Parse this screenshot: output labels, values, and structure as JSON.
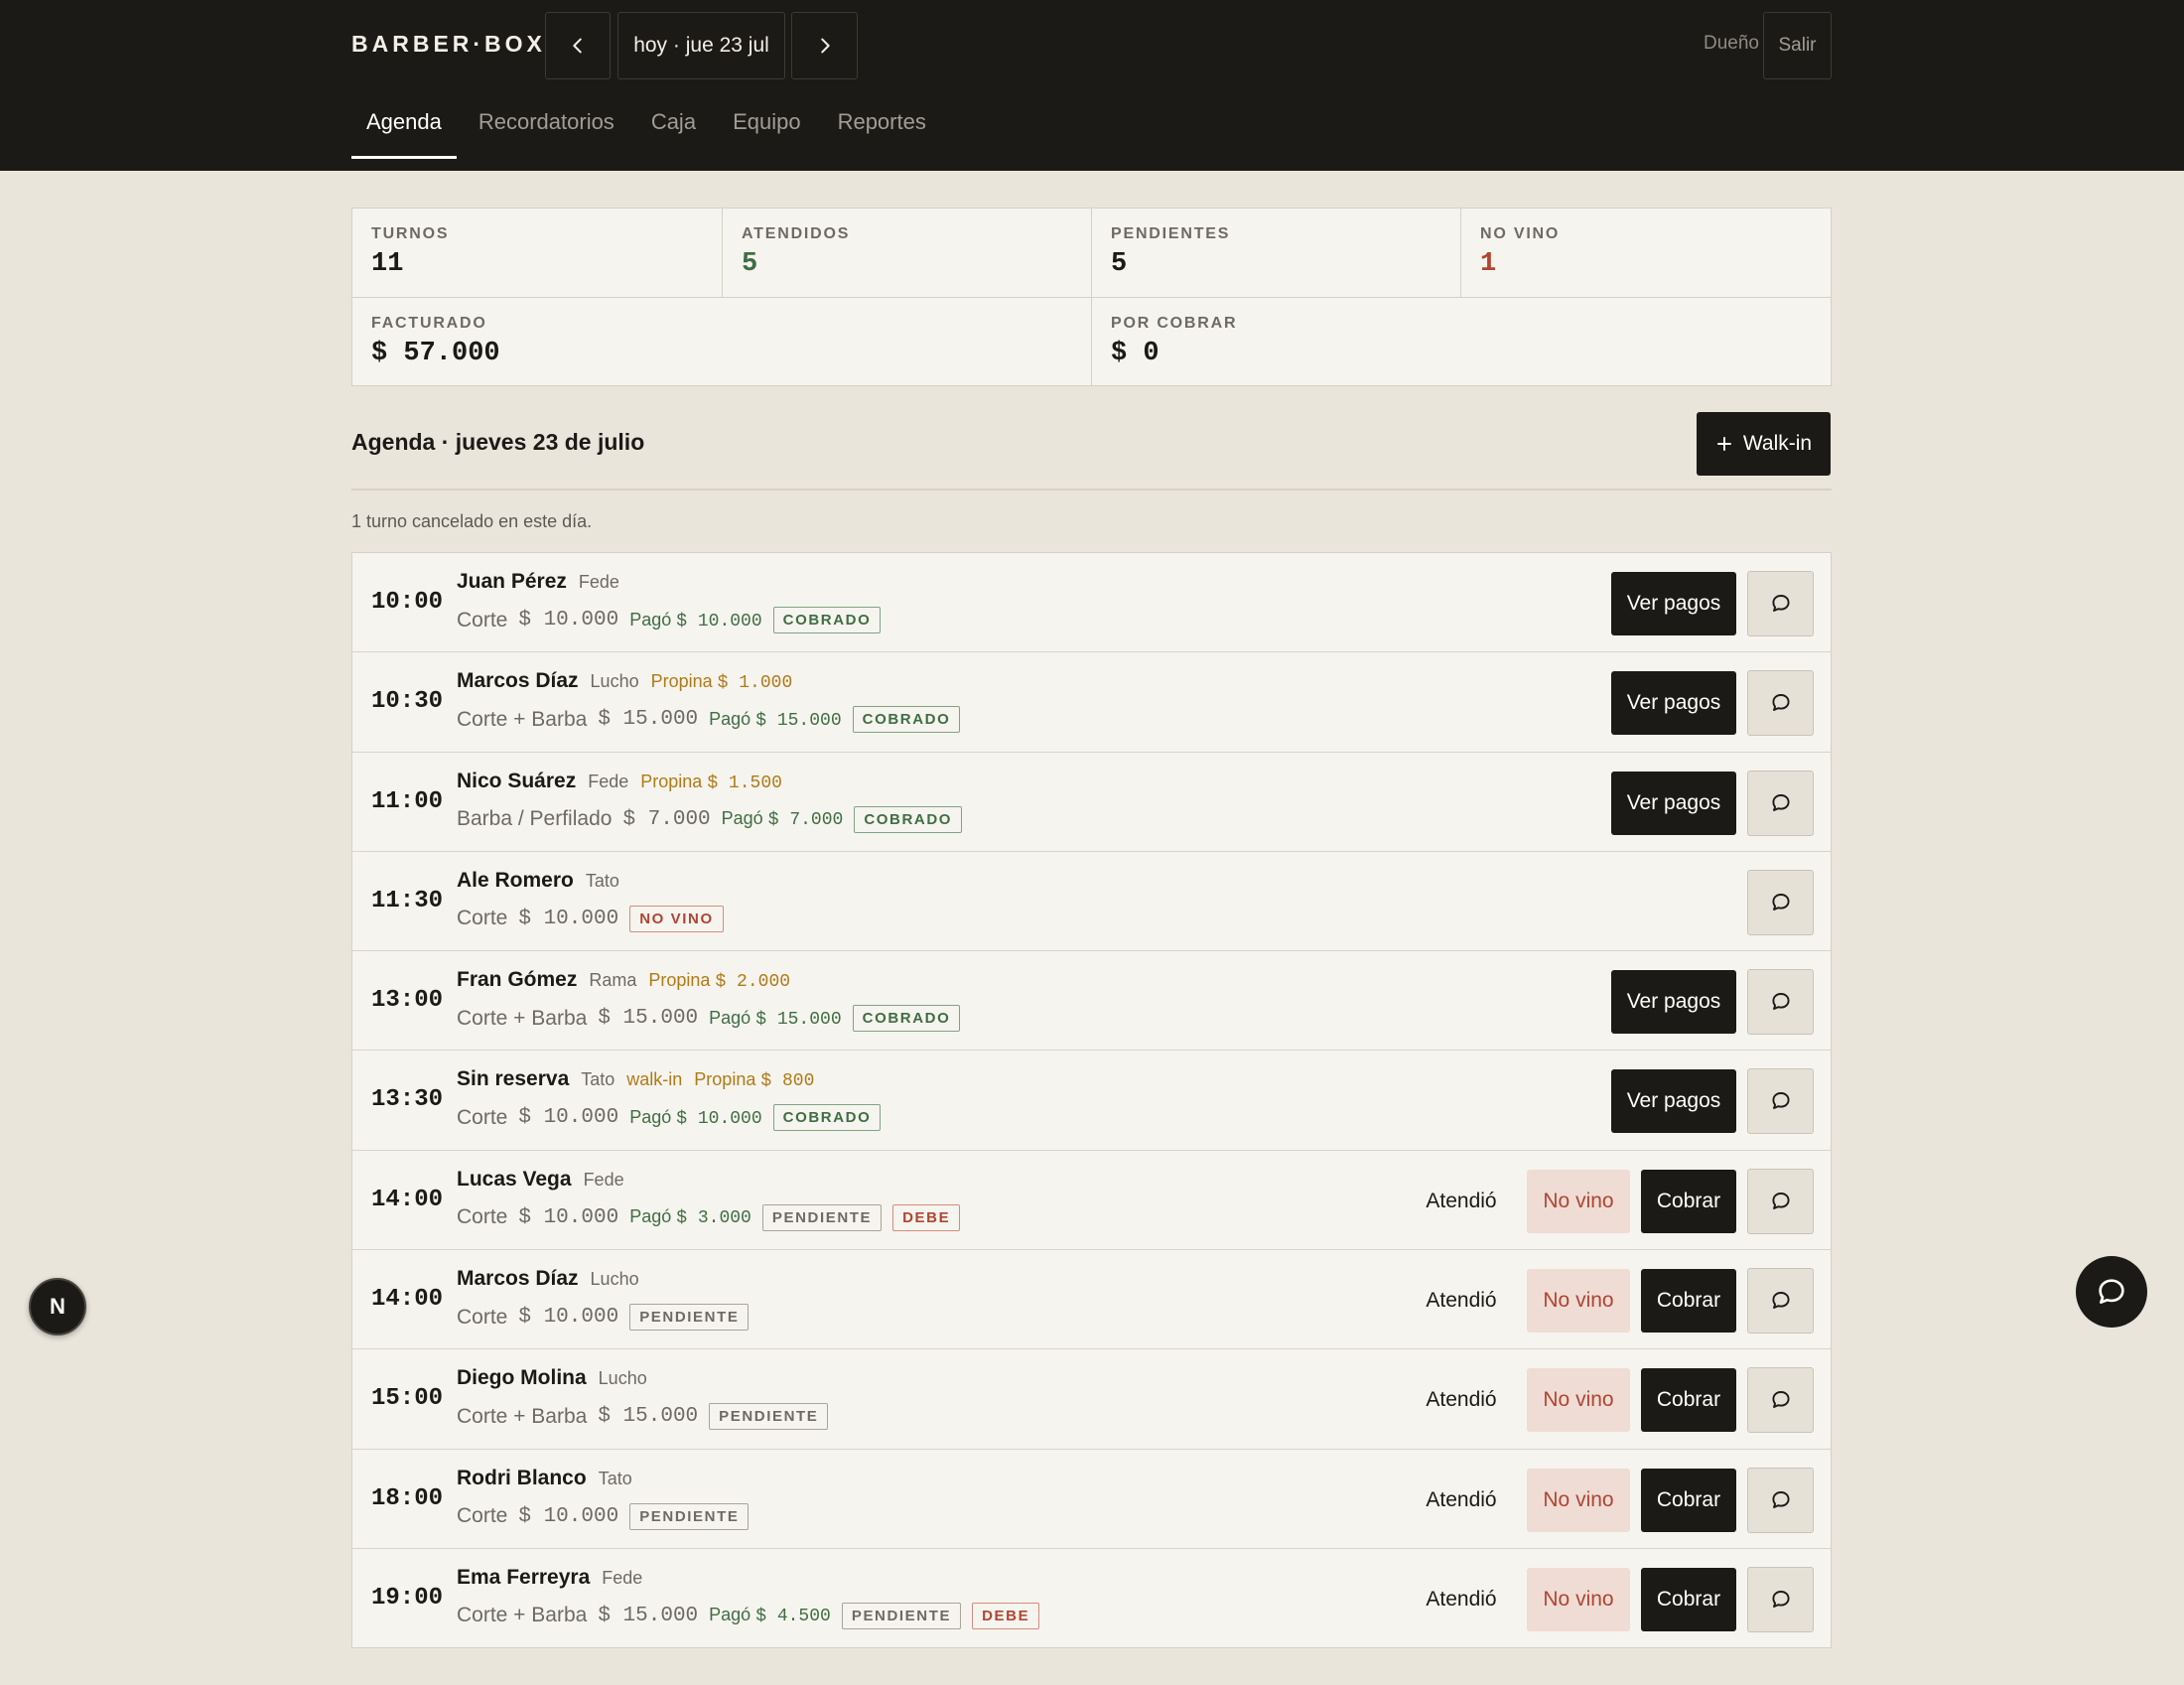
{
  "header": {
    "brand": "BARBER·BOX",
    "date_label": "hoy · jue 23 jul",
    "role": "Dueño",
    "logout_label": "Salir",
    "tabs": [
      {
        "label": "Agenda",
        "active": true
      },
      {
        "label": "Recordatorios",
        "active": false
      },
      {
        "label": "Caja",
        "active": false
      },
      {
        "label": "Equipo",
        "active": false
      },
      {
        "label": "Reportes",
        "active": false
      }
    ]
  },
  "stats": {
    "turnos": {
      "label": "TURNOS",
      "value": "11"
    },
    "atendidos": {
      "label": "ATENDIDOS",
      "value": "5"
    },
    "pendientes": {
      "label": "PENDIENTES",
      "value": "5"
    },
    "no_vino": {
      "label": "NO VINO",
      "value": "1"
    },
    "facturado": {
      "label": "FACTURADO",
      "value": "$ 57.000"
    },
    "por_cobrar": {
      "label": "POR COBRAR",
      "value": "$ 0"
    }
  },
  "agenda": {
    "title": "Agenda · jueves 23 de julio",
    "walkin_label": "Walk-in",
    "cancel_note": "1 turno cancelado en este día.",
    "labels": {
      "ver_pagos": "Ver pagos",
      "atendio": "Atendió",
      "no_vino": "No vino",
      "cobrar": "Cobrar",
      "pago": "Pagó",
      "propina": "Propina"
    },
    "rows": [
      {
        "time": "10:00",
        "client": "Juan Pérez",
        "barber": "Fede",
        "tag": "",
        "tip": "",
        "service": "Corte",
        "price": "$ 10.000",
        "paid": "$ 10.000",
        "badges": [
          {
            "text": "COBRADO",
            "kind": "cobrado"
          }
        ],
        "mode": "paid"
      },
      {
        "time": "10:30",
        "client": "Marcos Díaz",
        "barber": "Lucho",
        "tag": "",
        "tip": "$ 1.000",
        "service": "Corte + Barba",
        "price": "$ 15.000",
        "paid": "$ 15.000",
        "badges": [
          {
            "text": "COBRADO",
            "kind": "cobrado"
          }
        ],
        "mode": "paid"
      },
      {
        "time": "11:00",
        "client": "Nico Suárez",
        "barber": "Fede",
        "tag": "",
        "tip": "$ 1.500",
        "service": "Barba / Perfilado",
        "price": "$ 7.000",
        "paid": "$ 7.000",
        "badges": [
          {
            "text": "COBRADO",
            "kind": "cobrado"
          }
        ],
        "mode": "paid"
      },
      {
        "time": "11:30",
        "client": "Ale Romero",
        "barber": "Tato",
        "tag": "",
        "tip": "",
        "service": "Corte",
        "price": "$ 10.000",
        "paid": "",
        "badges": [
          {
            "text": "NO VINO",
            "kind": "novino"
          }
        ],
        "mode": "noshow"
      },
      {
        "time": "13:00",
        "client": "Fran Gómez",
        "barber": "Rama",
        "tag": "",
        "tip": "$ 2.000",
        "service": "Corte + Barba",
        "price": "$ 15.000",
        "paid": "$ 15.000",
        "badges": [
          {
            "text": "COBRADO",
            "kind": "cobrado"
          }
        ],
        "mode": "paid"
      },
      {
        "time": "13:30",
        "client": "Sin reserva",
        "barber": "Tato",
        "tag": "walk-in",
        "tip": "$ 800",
        "service": "Corte",
        "price": "$ 10.000",
        "paid": "$ 10.000",
        "badges": [
          {
            "text": "COBRADO",
            "kind": "cobrado"
          }
        ],
        "mode": "paid"
      },
      {
        "time": "14:00",
        "client": "Lucas Vega",
        "barber": "Fede",
        "tag": "",
        "tip": "",
        "service": "Corte",
        "price": "$ 10.000",
        "paid": "$ 3.000",
        "badges": [
          {
            "text": "PENDIENTE",
            "kind": "pendiente"
          },
          {
            "text": "DEBE",
            "kind": "debe"
          }
        ],
        "mode": "pending"
      },
      {
        "time": "14:00",
        "client": "Marcos Díaz",
        "barber": "Lucho",
        "tag": "",
        "tip": "",
        "service": "Corte",
        "price": "$ 10.000",
        "paid": "",
        "badges": [
          {
            "text": "PENDIENTE",
            "kind": "pendiente"
          }
        ],
        "mode": "pending"
      },
      {
        "time": "15:00",
        "client": "Diego Molina",
        "barber": "Lucho",
        "tag": "",
        "tip": "",
        "service": "Corte + Barba",
        "price": "$ 15.000",
        "paid": "",
        "badges": [
          {
            "text": "PENDIENTE",
            "kind": "pendiente"
          }
        ],
        "mode": "pending"
      },
      {
        "time": "18:00",
        "client": "Rodri Blanco",
        "barber": "Tato",
        "tag": "",
        "tip": "",
        "service": "Corte",
        "price": "$ 10.000",
        "paid": "",
        "badges": [
          {
            "text": "PENDIENTE",
            "kind": "pendiente"
          }
        ],
        "mode": "pending"
      },
      {
        "time": "19:00",
        "client": "Ema Ferreyra",
        "barber": "Fede",
        "tag": "",
        "tip": "",
        "service": "Corte + Barba",
        "price": "$ 15.000",
        "paid": "$ 4.500",
        "badges": [
          {
            "text": "PENDIENTE",
            "kind": "pendiente"
          },
          {
            "text": "DEBE",
            "kind": "debe"
          }
        ],
        "mode": "pending"
      }
    ]
  },
  "floating": {
    "dev_badge": "N"
  },
  "colors": {
    "header_bg": "#1c1a16",
    "page_bg": "#e9e5db",
    "card_bg": "#f6f4ee",
    "ok_green": "#3f6e44",
    "alert_red": "#b04532",
    "tip_gold": "#b07a18"
  },
  "icons": {
    "prev": "chevron-left-icon",
    "next": "chevron-right-icon",
    "add": "plus-icon",
    "chat": "chat-bubble-icon"
  }
}
